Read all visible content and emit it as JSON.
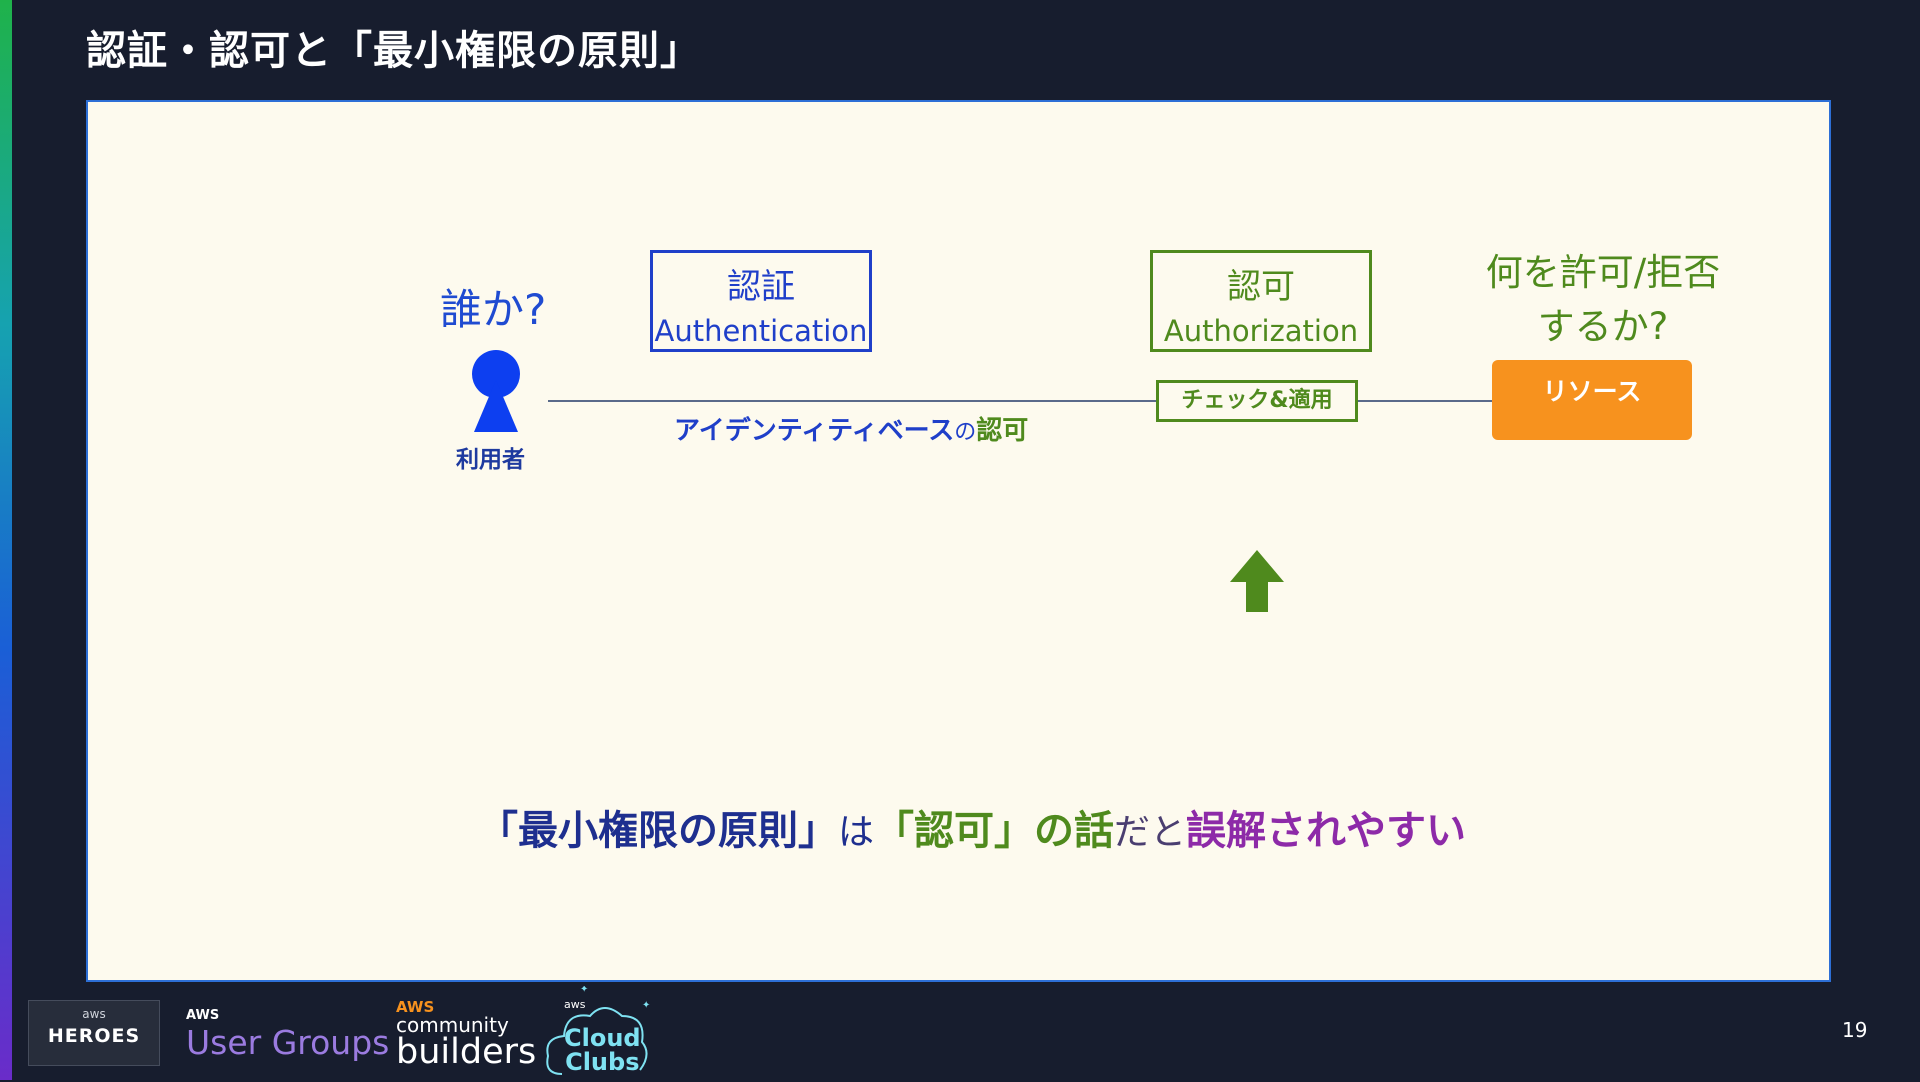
{
  "slide": {
    "title": "認証・認可と「最小権限の原則」",
    "page_number": "19"
  },
  "diagram": {
    "who_question": "誰か?",
    "user_label": "利用者",
    "authentication_jp": "認証",
    "authentication_en": "Authentication",
    "authorization_jp": "認可",
    "authorization_en": "Authorization",
    "check_apply": "チェック&適用",
    "identity_based_part1": "アイデンティティベース",
    "identity_based_part2": "の",
    "identity_based_part3": "認可",
    "question_line1": "何を許可/拒否",
    "question_line2": "するか?",
    "resource": "リソース"
  },
  "message": {
    "part1": "「最小権限の原則」",
    "part2": "は",
    "part3": "「認可」の話",
    "part4": "だと",
    "part5": "誤解されやすい"
  },
  "footer_logos": {
    "heroes_aws": "aws",
    "heroes": "HEROES",
    "user_groups_aws": "AWS",
    "user_groups": "User Groups",
    "community_aws": "AWS",
    "community": "community",
    "builders": "builders",
    "cloud_clubs_aws": "aws",
    "cloud": "Cloud",
    "clubs": "Clubs"
  },
  "colors": {
    "background": "#171d2e",
    "panel": "#fdfaee",
    "authentication": "#1f3fc9",
    "authorization": "#4f8a1d",
    "resource": "#f7921e",
    "misunderstand": "#8d2aa8"
  }
}
